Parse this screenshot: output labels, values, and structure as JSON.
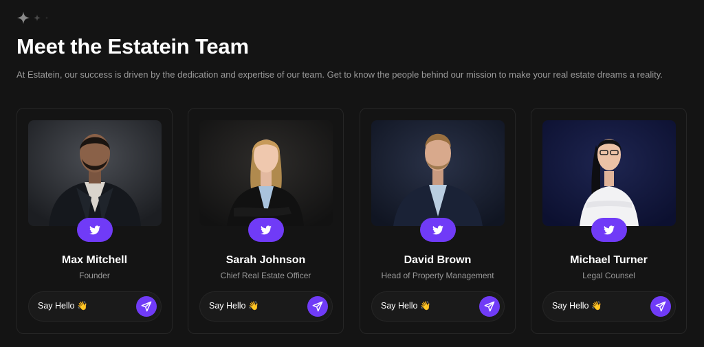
{
  "header": {
    "title": "Meet the Estatein Team",
    "subtitle": "At Estatein, our success is driven by the dedication and expertise of our team. Get to know the people behind our mission to make your real estate dreams a reality."
  },
  "colors": {
    "accent": "#703bf7",
    "background": "#141414",
    "card_border": "#262626",
    "muted_text": "#9a9a9a"
  },
  "team": [
    {
      "name": "Max Mitchell",
      "role": "Founder",
      "hello_label": "Say Hello 👋",
      "social_icon": "twitter-icon",
      "send_icon": "send-icon"
    },
    {
      "name": "Sarah Johnson",
      "role": "Chief Real Estate Officer",
      "hello_label": "Say Hello 👋",
      "social_icon": "twitter-icon",
      "send_icon": "send-icon"
    },
    {
      "name": "David Brown",
      "role": "Head of Property Management",
      "hello_label": "Say Hello 👋",
      "social_icon": "twitter-icon",
      "send_icon": "send-icon"
    },
    {
      "name": "Michael Turner",
      "role": "Legal Counsel",
      "hello_label": "Say Hello 👋",
      "social_icon": "twitter-icon",
      "send_icon": "send-icon"
    }
  ]
}
